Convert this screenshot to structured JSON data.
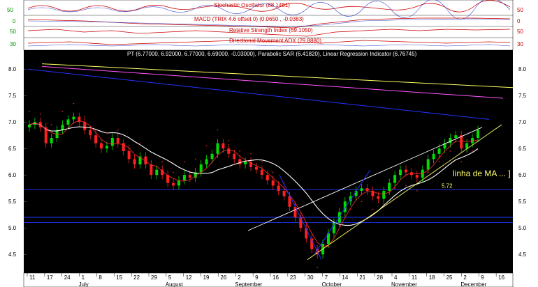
{
  "colors": {
    "background": "#000000",
    "panel_bg": "#ffffff",
    "up_candle": "#00dd00",
    "down_candle": "#ff2020",
    "ma": "#ffffff",
    "short_ma": "#ff3030",
    "sar": "#cc2222",
    "blue_line": "#2233ff",
    "yellow_line": "#ffff66",
    "magenta_line": "#ff55ff"
  },
  "indicators": [
    {
      "label": "Stochastic Oscillator (88.1481)",
      "left_tick": "50",
      "right_tick": "50"
    },
    {
      "label": "MACD (TRIX 4.6 offset 0) (0.0650 , -0.0383)",
      "left_tick": "0",
      "right_tick": "0"
    },
    {
      "label": "Relative Strength Index (69.1050)",
      "left_tick": "50",
      "right_tick": "50"
    },
    {
      "label": "Directional Movement ADX (29.8880)",
      "left_tick": "30",
      "right_tick": "30"
    }
  ],
  "chart_data": {
    "type": "candlestick",
    "title": "PT (6.77000, 6.92000, 6.77000, 6.69000, -0.03000), Parabolic SAR (6.41820), Linear Regression Indicator (6.76745)",
    "ylim": [
      4.2,
      8.2
    ],
    "y_ticks": [
      "8.0",
      "7.5",
      "7.0",
      "6.5",
      "6.0",
      "5.5",
      "5.0",
      "4.5"
    ],
    "x_ticks": [
      "11",
      "17",
      "24",
      "1",
      "8",
      "15",
      "22",
      "29",
      "5",
      "12",
      "19",
      "26",
      "2",
      "9",
      "16",
      "23",
      "30",
      "7",
      "14",
      "21",
      "28",
      "4",
      "11",
      "18",
      "25",
      "2",
      "9",
      "16"
    ],
    "months": [
      "July",
      "August",
      "September",
      "October",
      "November",
      "December"
    ],
    "candles_close": [
      6.95,
      7.0,
      6.9,
      6.6,
      6.7,
      6.85,
      6.95,
      7.05,
      7.1,
      7.0,
      6.85,
      6.75,
      6.6,
      6.5,
      6.55,
      6.7,
      6.6,
      6.45,
      6.3,
      6.2,
      6.35,
      6.2,
      6.0,
      6.1,
      6.0,
      5.85,
      5.8,
      5.9,
      6.0,
      5.95,
      6.05,
      6.2,
      6.3,
      6.4,
      6.6,
      6.5,
      6.4,
      6.3,
      6.2,
      6.25,
      6.15,
      6.1,
      6.0,
      5.9,
      5.8,
      5.7,
      5.6,
      5.4,
      5.2,
      5.0,
      4.8,
      4.6,
      4.5,
      4.7,
      4.9,
      5.1,
      5.3,
      5.5,
      5.6,
      5.7,
      5.75,
      5.7,
      5.6,
      5.55,
      5.7,
      5.85,
      6.0,
      6.1,
      6.05,
      6.0,
      5.95,
      6.1,
      6.3,
      6.4,
      6.5,
      6.6,
      6.7,
      6.75,
      6.5,
      6.6,
      6.7,
      6.85
    ],
    "annotations": [
      {
        "text": "linha de MA ... ]",
        "value": 6.0
      },
      {
        "text": "5.72",
        "value": 5.72
      }
    ],
    "horizontal_levels": [
      5.72,
      5.2,
      5.1
    ],
    "legend": "top"
  }
}
